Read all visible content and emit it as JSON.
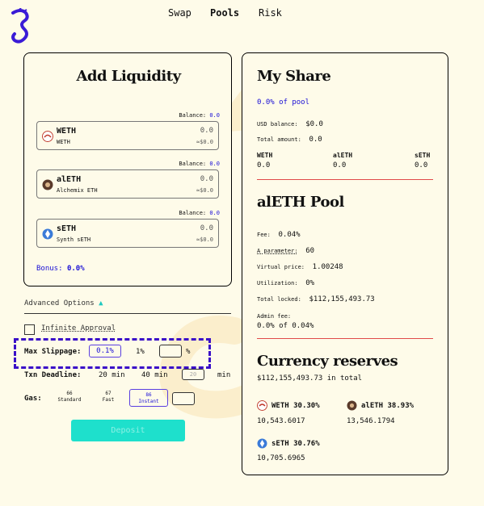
{
  "nav": {
    "swap": "Swap",
    "pools": "Pools",
    "risk": "Risk"
  },
  "add_liquidity": {
    "title": "Add Liquidity",
    "balance_label": "Balance:",
    "tokens": [
      {
        "symbol": "WETH",
        "name": "WETH",
        "balance": "0.0",
        "amount": "0.0",
        "usd": "≈$0.0"
      },
      {
        "symbol": "alETH",
        "name": "Alchemix ETH",
        "balance": "0.0",
        "amount": "0.0",
        "usd": "≈$0.0"
      },
      {
        "symbol": "sETH",
        "name": "Synth sETH",
        "balance": "0.0",
        "amount": "0.0",
        "usd": "≈$0.0"
      }
    ],
    "bonus_label": "Bonus:",
    "bonus_value": "0.0%"
  },
  "advanced": {
    "toggle_label": "Advanced Options",
    "infinite_approval": "Infinite Approval",
    "max_slippage_label": "Max Slippage:",
    "slippage_options": [
      "0.1%",
      "1%"
    ],
    "slippage_custom_suffix": "%",
    "txn_deadline_label": "Txn Deadline:",
    "deadline_options": [
      "20 min",
      "40 min"
    ],
    "deadline_placeholder": "20",
    "deadline_suffix": "min",
    "gas_label": "Gas:",
    "gas_options": [
      {
        "value": "66",
        "label": "Standard"
      },
      {
        "value": "67",
        "label": "Fast"
      },
      {
        "value": "86",
        "label": "Instant"
      }
    ]
  },
  "deposit_label": "Deposit",
  "my_share": {
    "title": "My Share",
    "pct_of_pool": "0.0% of pool",
    "usd_balance_label": "USD balance:",
    "usd_balance": "$0.0",
    "total_amount_label": "Total amount:",
    "total_amount": "0.0",
    "tokens": [
      {
        "symbol": "WETH",
        "value": "0.0"
      },
      {
        "symbol": "alETH",
        "value": "0.0"
      },
      {
        "symbol": "sETH",
        "value": "0.0"
      }
    ]
  },
  "pool": {
    "title": "alETH Pool",
    "fee_label": "Fee:",
    "fee": "0.04%",
    "a_param_label": "A parameter:",
    "a_param": "60",
    "virtual_price_label": "Virtual price:",
    "virtual_price": "1.00248",
    "utilization_label": "Utilization:",
    "utilization": "0%",
    "total_locked_label": "Total locked:",
    "total_locked": "$112,155,493.73",
    "admin_fee_label": "Admin fee:",
    "admin_fee": "0.0% of 0.04%"
  },
  "reserves": {
    "title": "Currency reserves",
    "total": "$112,155,493.73 in total",
    "items": [
      {
        "symbol": "WETH",
        "pct": "30.30%",
        "amount": "10,543.6017"
      },
      {
        "symbol": "alETH",
        "pct": "38.93%",
        "amount": "13,546.1794"
      },
      {
        "symbol": "sETH",
        "pct": "30.76%",
        "amount": "10,705.6965"
      }
    ]
  },
  "colors": {
    "background": "#fefbe9",
    "accent_blue": "#1a0fd6",
    "deposit": "#1ee0cc",
    "highlight": "#3a0fc8",
    "divider": "#e04a4a"
  }
}
